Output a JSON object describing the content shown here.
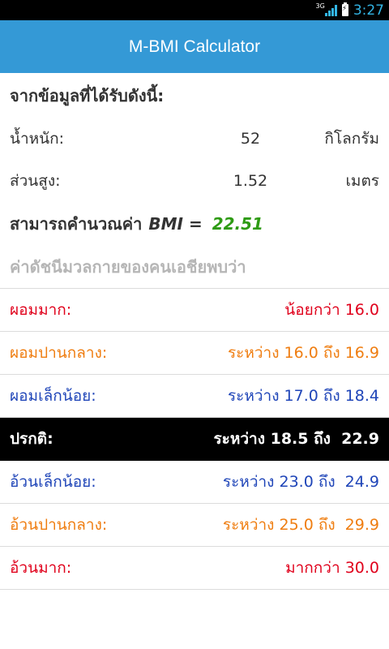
{
  "status_bar": {
    "network": "3G",
    "time": "3:27"
  },
  "app_bar": {
    "title": "M-BMI Calculator"
  },
  "intro": {
    "text": "จากข้อมูลที่ได้รับดังนี้:"
  },
  "weight": {
    "label": "น้ำหนัก:",
    "value": "52",
    "unit": "กิโลกรัม"
  },
  "height": {
    "label": "ส่วนสูง:",
    "value": "1.52",
    "unit": "เมตร"
  },
  "bmi": {
    "prefix": "สามารถคำนวณค่า",
    "label": "BMI =",
    "value": "22.51",
    "value_color": "#2e9b14"
  },
  "section": {
    "title": "ค่าดัชนีมวลกายของคนเอชียพบว่า"
  },
  "categories": [
    {
      "label": "ผอมมาก:",
      "range": "น้อยกว่า 16.0",
      "color": "#e0001b"
    },
    {
      "label": "ผอมปานกลาง:",
      "range": "ระหว่าง 16.0 ถึง 16.9",
      "color": "#ef7d10"
    },
    {
      "label": "ผอมเล็กน้อย:",
      "range": "ระหว่าง 17.0 ถึง 18.4",
      "color": "#1f45b8"
    },
    {
      "label": "ปรกติ:",
      "range": "ระหว่าง 18.5 ถึง  22.9",
      "color": "#ffffff",
      "highlighted": true
    },
    {
      "label": "อ้วนเล็กน้อย:",
      "range": "ระหว่าง 23.0 ถึง  24.9",
      "color": "#1f45b8"
    },
    {
      "label": "อ้วนปานกลาง:",
      "range": "ระหว่าง 25.0 ถึง  29.9",
      "color": "#ef7d10"
    },
    {
      "label": "อ้วนมาก:",
      "range": "มากกว่า 30.0",
      "color": "#e0001b"
    }
  ]
}
